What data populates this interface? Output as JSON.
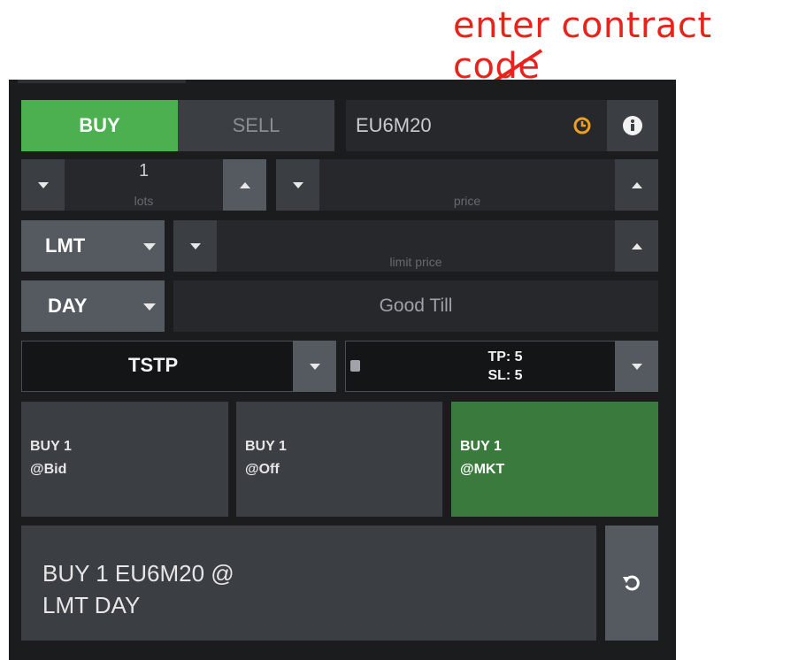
{
  "annotation": {
    "text": "enter contract code",
    "color": "#e8231b"
  },
  "side": {
    "buy_label": "BUY",
    "sell_label": "SELL",
    "buy_color": "#4caf50"
  },
  "contract": {
    "value": "EU6M20",
    "clock_icon": "clock-icon",
    "info_icon": "info-icon"
  },
  "quantity": {
    "value": "1",
    "unit_label": "lots"
  },
  "price": {
    "value": "",
    "placeholder": "price"
  },
  "order_type": {
    "selected": "LMT"
  },
  "limit_price": {
    "value": "",
    "placeholder": "limit price"
  },
  "time_in_force": {
    "selected": "DAY",
    "good_till_placeholder": "Good Till"
  },
  "bracket": {
    "selected": "TSTP",
    "tp_label": "TP: 5",
    "sl_label": "SL: 5"
  },
  "quick_orders": [
    {
      "line1": "BUY 1",
      "line2": "@Bid"
    },
    {
      "line1": "BUY 1",
      "line2": "@Off"
    },
    {
      "line1": "BUY 1",
      "line2": "@MKT"
    }
  ],
  "summary": {
    "line1": "BUY 1 EU6M20 @",
    "line2": "LMT DAY",
    "reset_icon": "reset-icon"
  },
  "colors": {
    "panel_bg": "#1b1c1e",
    "button_bg": "#3b3e43",
    "input_bg": "#26282b",
    "market_green": "#3a7a3c",
    "clock_orange": "#f0a020"
  }
}
